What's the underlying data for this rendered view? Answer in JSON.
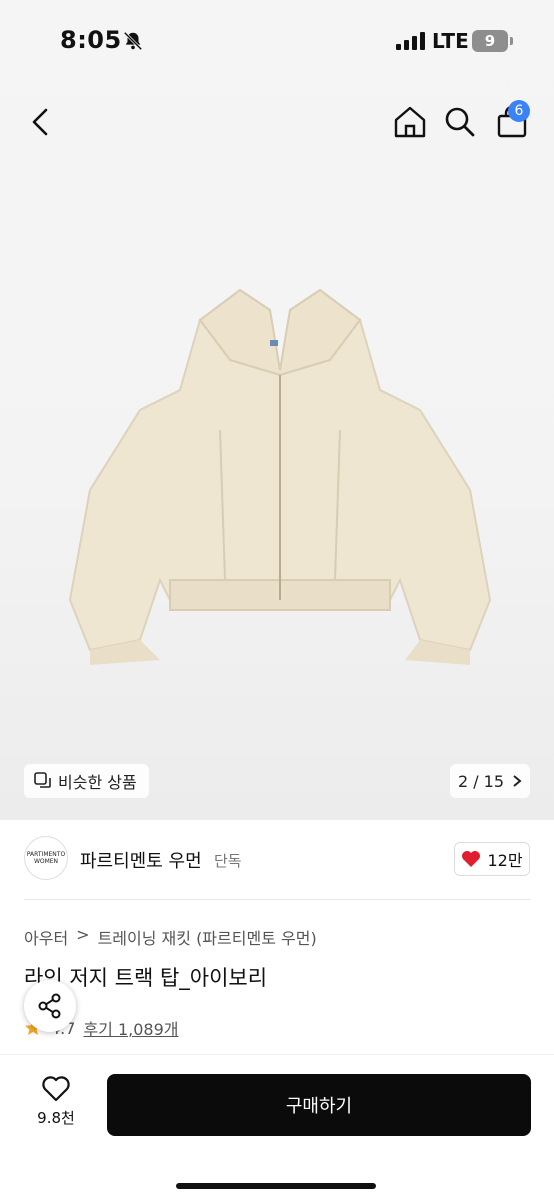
{
  "status_bar": {
    "time": "8:05",
    "network": "LTE",
    "battery": "9"
  },
  "nav": {
    "cart_count": "6"
  },
  "gallery": {
    "similar_label": "비슷한 상품",
    "page_counter": "2 / 15"
  },
  "brand": {
    "logo_line1": "PARTIMENTO",
    "logo_line2": "WOMEN",
    "name": "파르티멘토 우먼",
    "tag": "단독",
    "likes": "12만"
  },
  "product": {
    "breadcrumb": [
      "아우터",
      "트레이닝 재킷 (파르티멘토 우먼)"
    ],
    "title": "라인 저지 트랙 탑_아이보리",
    "rating": "4.7",
    "reviews": "후기 1,089개"
  },
  "bottom_bar": {
    "wish_count": "9.8천",
    "buy_label": "구매하기"
  },
  "colors": {
    "accent_badge": "#3b82f6",
    "heart": "#e11d2e",
    "buy_button": "#0b0b0b",
    "jacket": "#efe6d2"
  },
  "icons": [
    "bell-muted-icon",
    "signal-icon",
    "back-chevron-icon",
    "home-icon",
    "search-icon",
    "bag-icon",
    "similar-icon",
    "chevron-right-icon",
    "heart-filled-icon",
    "share-icon",
    "star-icon",
    "heart-outline-icon"
  ]
}
